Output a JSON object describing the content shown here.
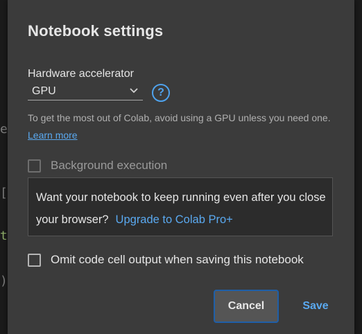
{
  "dialog": {
    "title": "Notebook settings",
    "hardware": {
      "label": "Hardware accelerator",
      "selected": "GPU",
      "help_glyph": "?",
      "hint_text": "To get the most out of Colab, avoid using a GPU unless you need one.",
      "learn_more": "Learn more"
    },
    "background": {
      "label": "Background execution",
      "checked": false
    },
    "promo": {
      "text": "Want your notebook to keep running even after you close your browser?",
      "upgrade_link": "Upgrade to Colab Pro+"
    },
    "omit_output": {
      "label": "Omit code cell output when saving this notebook",
      "checked": false
    },
    "buttons": {
      "cancel": "Cancel",
      "save": "Save"
    }
  },
  "backdrop": {
    "glyphs": [
      "e",
      "[",
      "t",
      ")"
    ]
  },
  "colors": {
    "accent": "#5aa9f0",
    "dialog_bg": "#3b3b3b",
    "focus_border": "#1f5fa8"
  },
  "icons": {
    "select": "chevron-down-icon",
    "help": "help-circle-icon"
  }
}
